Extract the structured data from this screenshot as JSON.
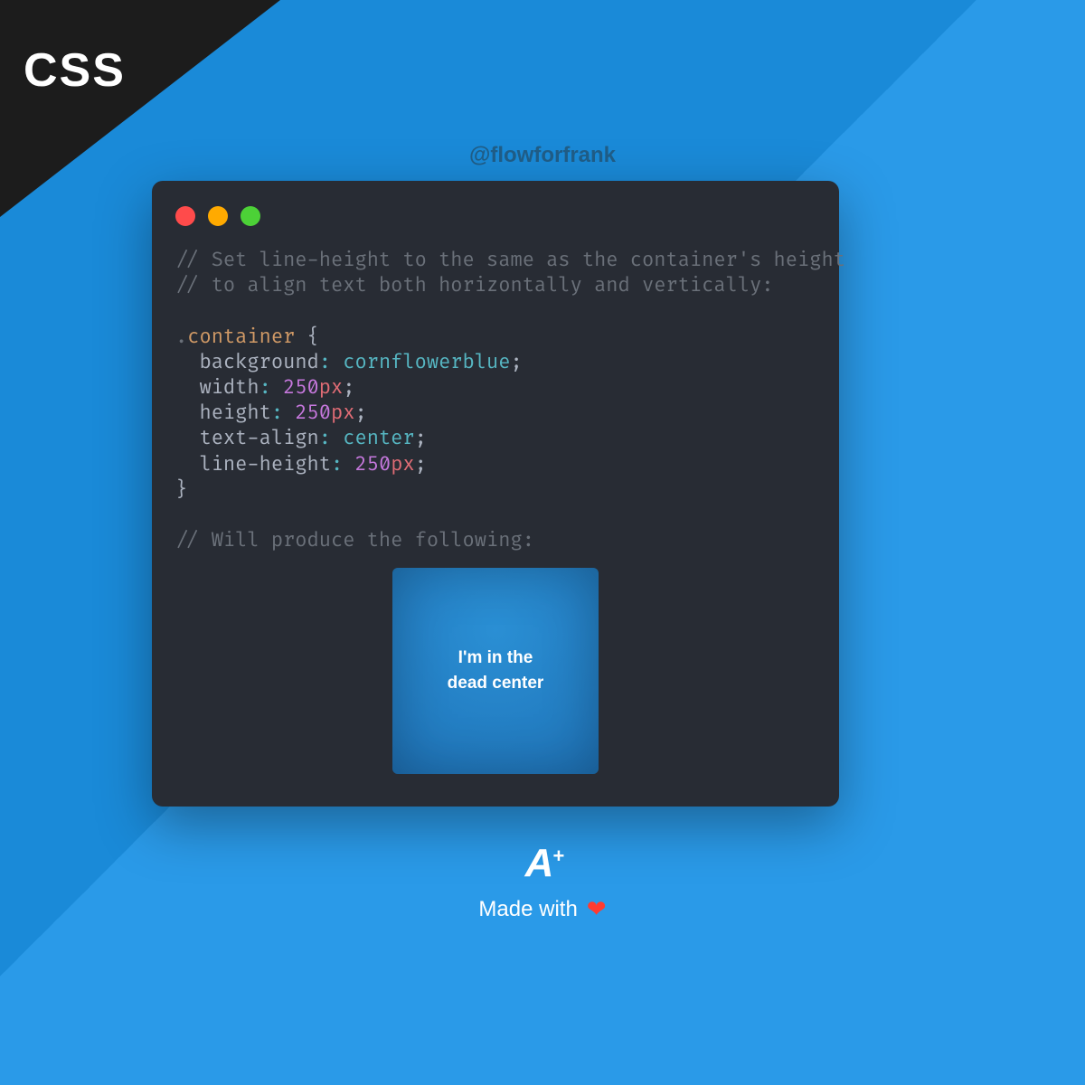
{
  "corner_label": "CSS",
  "handle": "@flowforfrank",
  "code": {
    "comment1": "// Set line-height to the same as the container's height",
    "comment2": "// to align text both horizontally and vertically:",
    "selector_dot": ".",
    "selector_name": "container",
    "brace_open": " {",
    "prop1": "background",
    "val1": "cornflowerblue",
    "prop2": "width",
    "num2": "250",
    "unit2": "px",
    "prop3": "height",
    "num3": "250",
    "unit3": "px",
    "prop4": "text-align",
    "val4": "center",
    "prop5": "line-height",
    "num5": "250",
    "unit5": "px",
    "brace_close": "}",
    "comment3": "// Will produce the following:"
  },
  "demo": {
    "line1": "I'm in the",
    "line2": "dead center"
  },
  "footer": {
    "logo_a": "A",
    "logo_plus": "+",
    "made": "Made with",
    "heart": "❤"
  }
}
